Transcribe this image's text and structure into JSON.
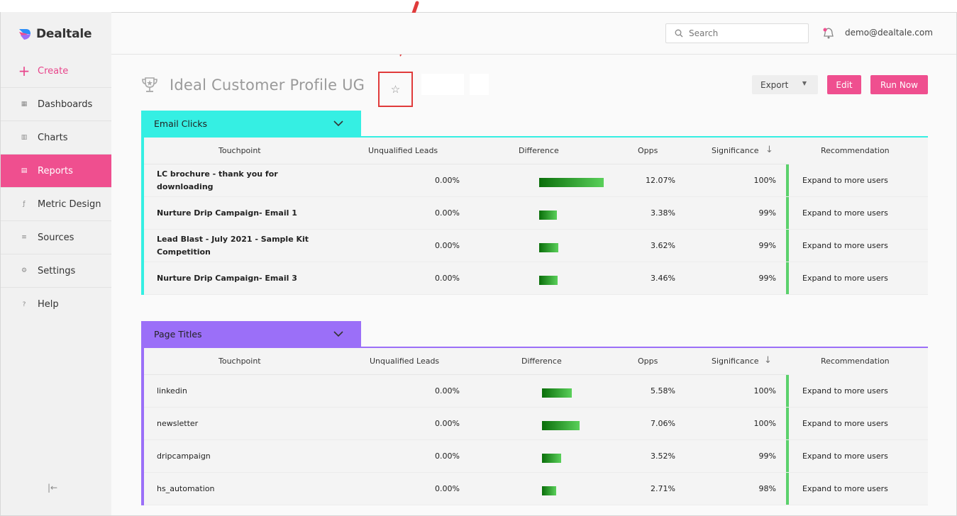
{
  "app": {
    "name": "Dealtale"
  },
  "sidebar": {
    "items": [
      {
        "label": "Create",
        "icon": "plus-icon"
      },
      {
        "label": "Dashboards",
        "icon": "grid-icon"
      },
      {
        "label": "Charts",
        "icon": "bar-chart-icon"
      },
      {
        "label": "Reports",
        "icon": "document-icon"
      },
      {
        "label": "Metric Design",
        "icon": "function-icon"
      },
      {
        "label": "Sources",
        "icon": "database-icon"
      },
      {
        "label": "Settings",
        "icon": "gear-icon"
      },
      {
        "label": "Help",
        "icon": "question-icon"
      }
    ],
    "active": "Reports",
    "collapse_glyph": "|←"
  },
  "topbar": {
    "search_placeholder": "Search",
    "user_email": "demo@dealtale.com"
  },
  "report": {
    "title": "Ideal Customer Profile UG",
    "export_label": "Export",
    "edit_label": "Edit",
    "run_label": "Run Now",
    "star_glyph": "☆"
  },
  "columns": {
    "touchpoint": "Touchpoint",
    "unqualified": "Unqualified Leads",
    "difference": "Difference",
    "opps": "Opps",
    "significance": "Significance",
    "recommendation": "Recommendation"
  },
  "colors": {
    "accent": "#ef4f8f",
    "email_section": "#35efe3",
    "page_section": "#9b6ff8",
    "recommendation_line": "#5bd16c",
    "highlight": "#e03b3b"
  },
  "sections": [
    {
      "name": "Email Clicks",
      "rows": [
        {
          "touchpoint": "LC brochure - thank you for downloading",
          "unqualified": "0.00%",
          "difference": 12.07,
          "opps": "12.07%",
          "significance": "100%",
          "recommendation": "Expand to more users"
        },
        {
          "touchpoint": "Nurture Drip Campaign- Email 1",
          "unqualified": "0.00%",
          "difference": 3.38,
          "opps": "3.38%",
          "significance": "99%",
          "recommendation": "Expand to more users"
        },
        {
          "touchpoint": "Lead Blast - July 2021 - Sample Kit Competition",
          "unqualified": "0.00%",
          "difference": 3.62,
          "opps": "3.62%",
          "significance": "99%",
          "recommendation": "Expand to more users"
        },
        {
          "touchpoint": "Nurture Drip Campaign- Email 3",
          "unqualified": "0.00%",
          "difference": 3.46,
          "opps": "3.46%",
          "significance": "99%",
          "recommendation": "Expand to more users"
        }
      ]
    },
    {
      "name": "Page Titles",
      "rows": [
        {
          "touchpoint": "linkedin",
          "unqualified": "0.00%",
          "difference": 5.58,
          "opps": "5.58%",
          "significance": "100%",
          "recommendation": "Expand to more users"
        },
        {
          "touchpoint": "newsletter",
          "unqualified": "0.00%",
          "difference": 7.06,
          "opps": "7.06%",
          "significance": "100%",
          "recommendation": "Expand to more users"
        },
        {
          "touchpoint": "dripcampaign",
          "unqualified": "0.00%",
          "difference": 3.52,
          "opps": "3.52%",
          "significance": "99%",
          "recommendation": "Expand to more users"
        },
        {
          "touchpoint": "hs_automation",
          "unqualified": "0.00%",
          "difference": 2.71,
          "opps": "2.71%",
          "significance": "98%",
          "recommendation": "Expand to more users"
        }
      ]
    }
  ]
}
